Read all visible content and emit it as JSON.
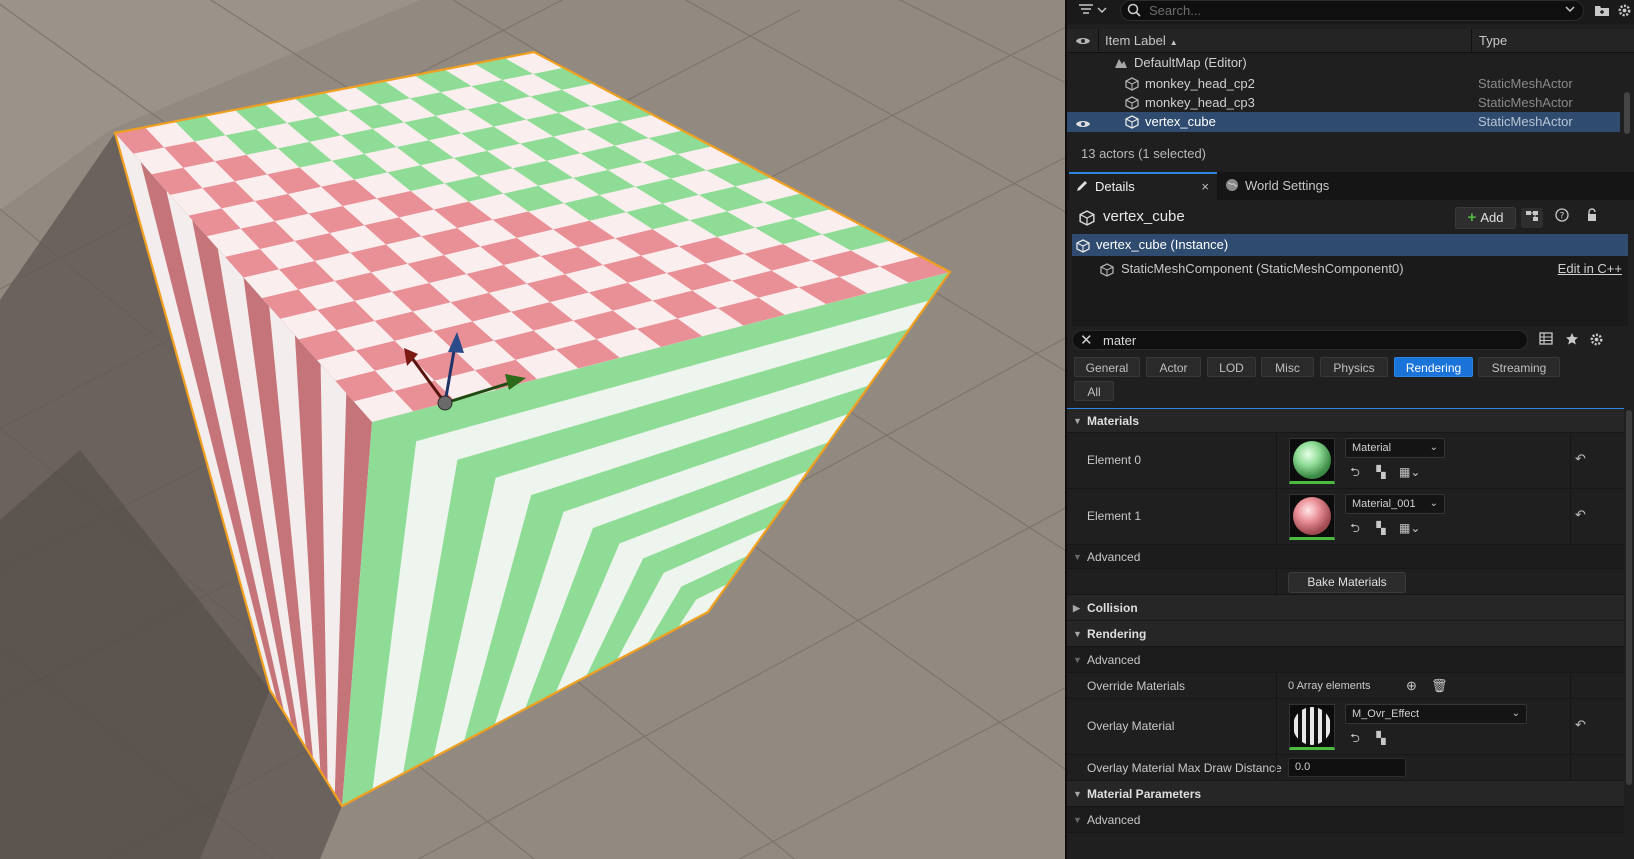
{
  "outliner": {
    "search_placeholder": "Search...",
    "col_item_label": "Item Label",
    "col_type": "Type",
    "rows": [
      {
        "label": "DefaultMap (Editor)",
        "type": ""
      },
      {
        "label": "monkey_head_cp2",
        "type": "StaticMeshActor"
      },
      {
        "label": "monkey_head_cp3",
        "type": "StaticMeshActor"
      },
      {
        "label": "vertex_cube",
        "type": "StaticMeshActor"
      }
    ],
    "footer": "13 actors (1 selected)"
  },
  "tabs": {
    "details": "Details",
    "world_settings": "World Settings",
    "close": "×"
  },
  "details": {
    "actor_name": "vertex_cube",
    "add_label": "Add",
    "add_plus": "+",
    "components": [
      {
        "label": "vertex_cube (Instance)"
      },
      {
        "label": "StaticMeshComponent (StaticMeshComponent0)"
      }
    ],
    "edit_link": "Edit in C++",
    "search_value": "mater",
    "categories": [
      "General",
      "Actor",
      "LOD",
      "Misc",
      "Physics",
      "Rendering",
      "Streaming",
      "All"
    ],
    "active_category": "Rendering"
  },
  "props": {
    "materials_cat": "Materials",
    "element0_label": "Element 0",
    "element0_value": "Material",
    "element1_label": "Element 1",
    "element1_value": "Material_001",
    "advanced_label": "Advanced",
    "bake_label": "Bake Materials",
    "collision_cat": "Collision",
    "rendering_cat": "Rendering",
    "advanced2_label": "Advanced",
    "override_label": "Override Materials",
    "override_value": "0 Array elements",
    "overlay_label": "Overlay Material",
    "overlay_value": "M_Ovr_Effect",
    "overlay_dist_label": "Overlay Material Max Draw Distance",
    "overlay_dist_value": "0.0",
    "material_params_cat": "Material Parameters",
    "advanced3_label": "Advanced"
  },
  "colors": {
    "accent": "#2b85e0",
    "selection": "#2f4b70",
    "green_material": "#8fdc96",
    "pink_material": "#e98f96",
    "gizmo_x": "#7a1a12",
    "gizmo_y": "#2d6b1a",
    "gizmo_z": "#2a4b8a"
  },
  "icons": {
    "filter": "filter-icon",
    "search": "search-icon",
    "eye": "eye-icon",
    "folder_add": "folder-add-icon",
    "settings": "gear-icon",
    "mesh": "static-mesh-icon",
    "map": "map-icon",
    "world": "globe-icon",
    "details": "pencil-icon",
    "help": "help-icon",
    "lock": "lock-icon",
    "blueprint": "blueprint-icon",
    "table": "table-view-icon",
    "star": "star-icon",
    "reset": "reset-arrow-icon",
    "add_element": "add-circle-icon",
    "delete": "trash-icon"
  }
}
